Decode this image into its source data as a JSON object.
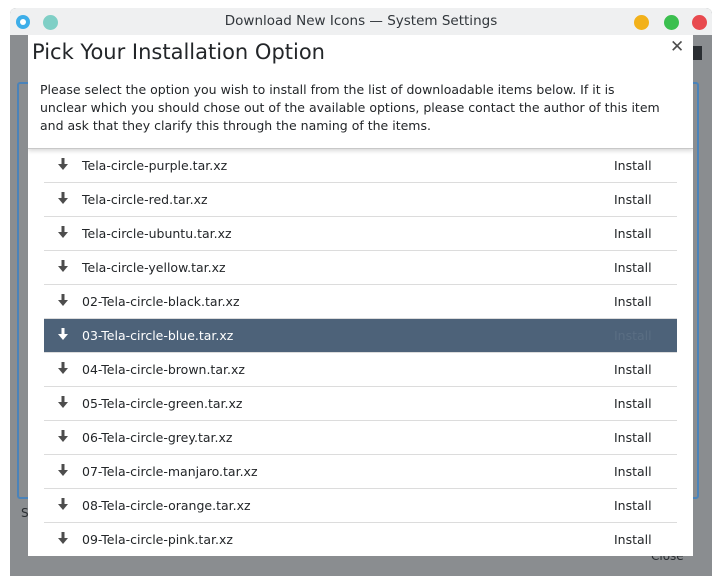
{
  "window": {
    "title": "Download New Icons — System Settings"
  },
  "background": {
    "left_label": "S",
    "right_label": "Close"
  },
  "dialog": {
    "title": "Pick Your Installation Option",
    "description": "Please select the option you wish to install from the list of downloadable items below. If it is unclear which you should chose out of the available options, please contact the author of this item and ask that they clarify this through the naming of the items.",
    "close_icon": "✕",
    "items": [
      {
        "label": "Tela-circle-purple.tar.xz",
        "action": "Install"
      },
      {
        "label": "Tela-circle-red.tar.xz",
        "action": "Install"
      },
      {
        "label": "Tela-circle-ubuntu.tar.xz",
        "action": "Install"
      },
      {
        "label": "Tela-circle-yellow.tar.xz",
        "action": "Install"
      },
      {
        "label": "02-Tela-circle-black.tar.xz",
        "action": "Install"
      },
      {
        "label": "03-Tela-circle-blue.tar.xz",
        "action": "Install",
        "selected": true
      },
      {
        "label": "04-Tela-circle-brown.tar.xz",
        "action": "Install"
      },
      {
        "label": "05-Tela-circle-green.tar.xz",
        "action": "Install"
      },
      {
        "label": "06-Tela-circle-grey.tar.xz",
        "action": "Install"
      },
      {
        "label": "07-Tela-circle-manjaro.tar.xz",
        "action": "Install"
      },
      {
        "label": "08-Tela-circle-orange.tar.xz",
        "action": "Install"
      },
      {
        "label": "09-Tela-circle-pink.tar.xz",
        "action": "Install"
      }
    ]
  },
  "colors": {
    "selection": "#4d6279",
    "accent": "#4a83ba",
    "window_close": "#e84a4f",
    "window_maximize": "#3bbf4f",
    "window_minimize": "#f2b11a"
  },
  "icons": {
    "app": "system-settings-icon",
    "pin": "keep-on-top-icon",
    "item": "download-arrow-icon"
  }
}
